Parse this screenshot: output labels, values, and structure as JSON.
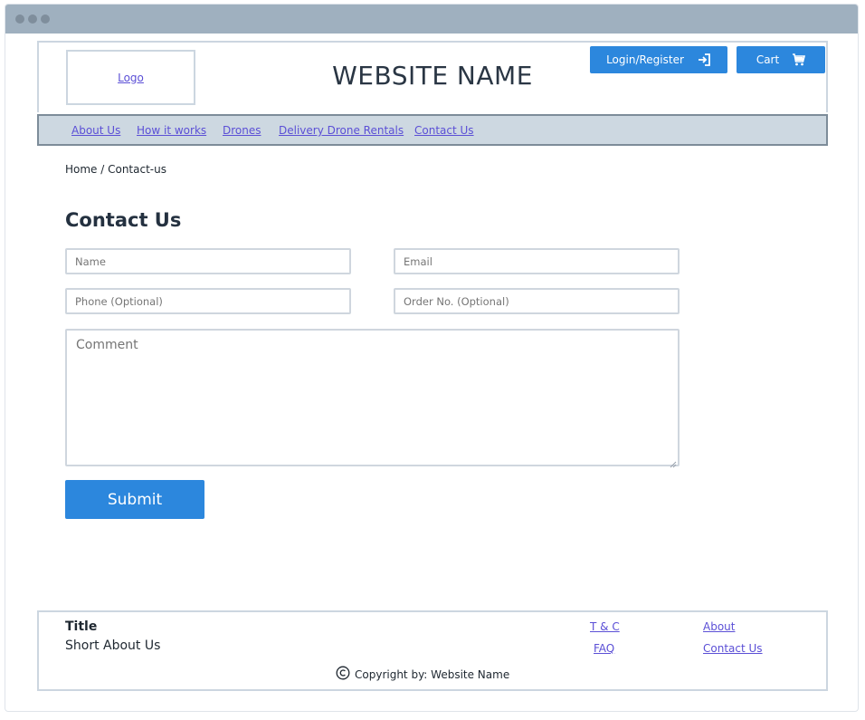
{
  "header": {
    "logo_label": "Logo",
    "site_name": "WEBSITE NAME",
    "login_label": "Login/Register",
    "cart_label": "Cart"
  },
  "nav": {
    "items": [
      {
        "label": "About Us"
      },
      {
        "label": "How it works"
      },
      {
        "label": "Drones"
      },
      {
        "label": "Delivery Drone Rentals"
      },
      {
        "label": "Contact Us"
      }
    ]
  },
  "breadcrumb": "Home / Contact-us",
  "form": {
    "heading": "Contact Us",
    "name_placeholder": "Name",
    "email_placeholder": "Email",
    "phone_placeholder": "Phone (Optional)",
    "order_placeholder": "Order No. (Optional)",
    "comment_placeholder": "Comment",
    "submit_label": "Submit"
  },
  "footer": {
    "title": "Title",
    "about": "Short About Us",
    "links": [
      {
        "label": "T & C"
      },
      {
        "label": "About"
      },
      {
        "label": "FAQ"
      },
      {
        "label": "Contact Us"
      }
    ],
    "copyright": "Copyright by: Website Name"
  },
  "colors": {
    "accent": "#2c87dd",
    "link": "#5b4fd6",
    "nav_bg": "#cdd8e1",
    "titlebar": "#9fb0bf"
  },
  "icons": [
    "sign-in-icon",
    "cart-icon",
    "copyright-icon",
    "resize-grip-icon"
  ]
}
